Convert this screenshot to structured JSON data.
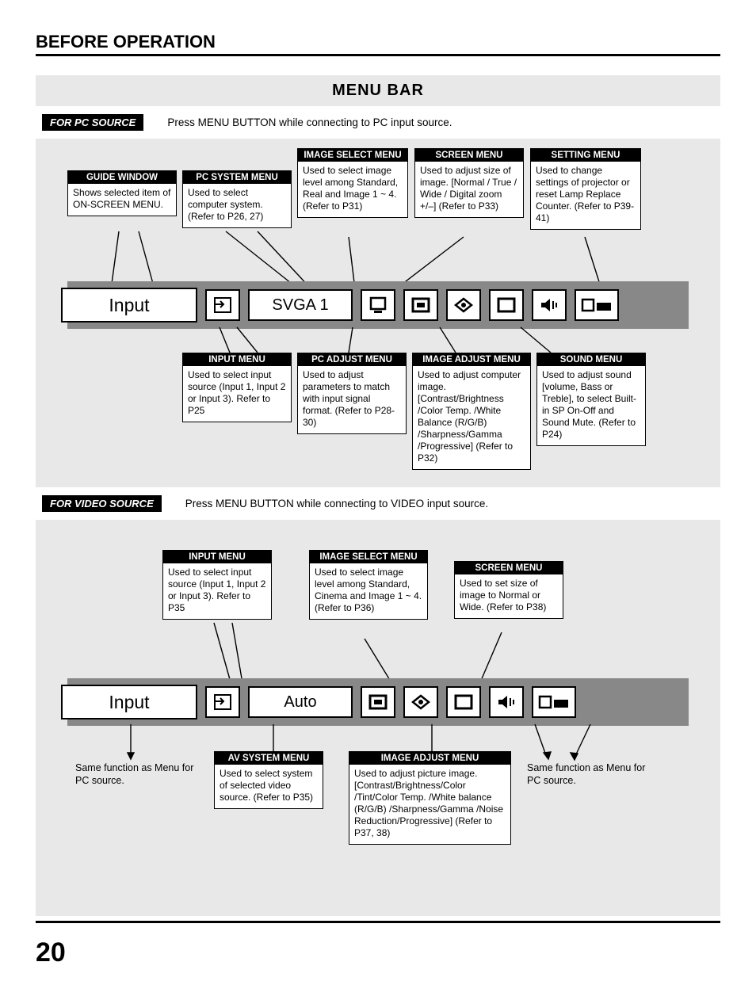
{
  "header": "BEFORE OPERATION",
  "title": "MENU BAR",
  "pc": {
    "chip": "FOR PC SOURCE",
    "desc": "Press MENU BUTTON while connecting to PC input source.",
    "guide": "Input",
    "system_text": "SVGA 1",
    "callouts": {
      "guide_window": {
        "t": "GUIDE WINDOW",
        "b": "Shows selected item of ON-SCREEN MENU."
      },
      "pc_system": {
        "t": "PC SYSTEM MENU",
        "b": "Used to select computer system. (Refer to P26, 27)"
      },
      "image_select": {
        "t": "IMAGE SELECT MENU",
        "b": "Used to select image level among Standard, Real and Image 1 ~ 4. (Refer to P31)"
      },
      "screen": {
        "t": "SCREEN MENU",
        "b": "Used to adjust size of image.  [Normal / True / Wide / Digital zoom +/–] (Refer to P33)"
      },
      "setting": {
        "t": "SETTING MENU",
        "b": "Used to change settings of projector or reset Lamp Replace Counter. (Refer to P39-41)"
      },
      "input": {
        "t": "INPUT MENU",
        "b": "Used to select input source (Input 1, Input 2 or Input 3). Refer to P25"
      },
      "pc_adjust": {
        "t": "PC ADJUST MENU",
        "b": "Used to adjust parameters to match with input signal format. (Refer to P28-30)"
      },
      "image_adjust": {
        "t": "IMAGE ADJUST MENU",
        "b": "Used to adjust computer image. [Contrast/Brightness /Color Temp. /White Balance (R/G/B) /Sharpness/Gamma /Progressive] (Refer to P32)"
      },
      "sound": {
        "t": "SOUND MENU",
        "b": "Used to adjust sound [volume, Bass or Treble], to select Built-in SP On-Off and Sound Mute. (Refer to P24)"
      }
    }
  },
  "video": {
    "chip": "FOR VIDEO SOURCE",
    "desc": "Press MENU BUTTON while connecting to VIDEO input source.",
    "guide": "Input",
    "system_text": "Auto",
    "callouts": {
      "input": {
        "t": "INPUT MENU",
        "b": "Used to select input source (Input 1, Input 2 or Input 3). Refer to P35"
      },
      "image_select": {
        "t": "IMAGE SELECT MENU",
        "b": "Used to select image level among Standard, Cinema and Image 1 ~ 4. (Refer to P36)"
      },
      "screen": {
        "t": "SCREEN MENU",
        "b": "Used to set size of image to Normal or Wide. (Refer to P38)"
      },
      "av_system": {
        "t": "AV SYSTEM MENU",
        "b": "Used to select system of selected video source. (Refer to P35)"
      },
      "image_adjust": {
        "t": "IMAGE ADJUST MENU",
        "b": "Used to adjust picture image. [Contrast/Brightness/Color /Tint/Color Temp. /White balance (R/G/B) /Sharpness/Gamma /Noise Reduction/Progressive] (Refer to P37, 38)"
      }
    },
    "same_note": "Same function as Menu for PC source."
  },
  "page": "20"
}
